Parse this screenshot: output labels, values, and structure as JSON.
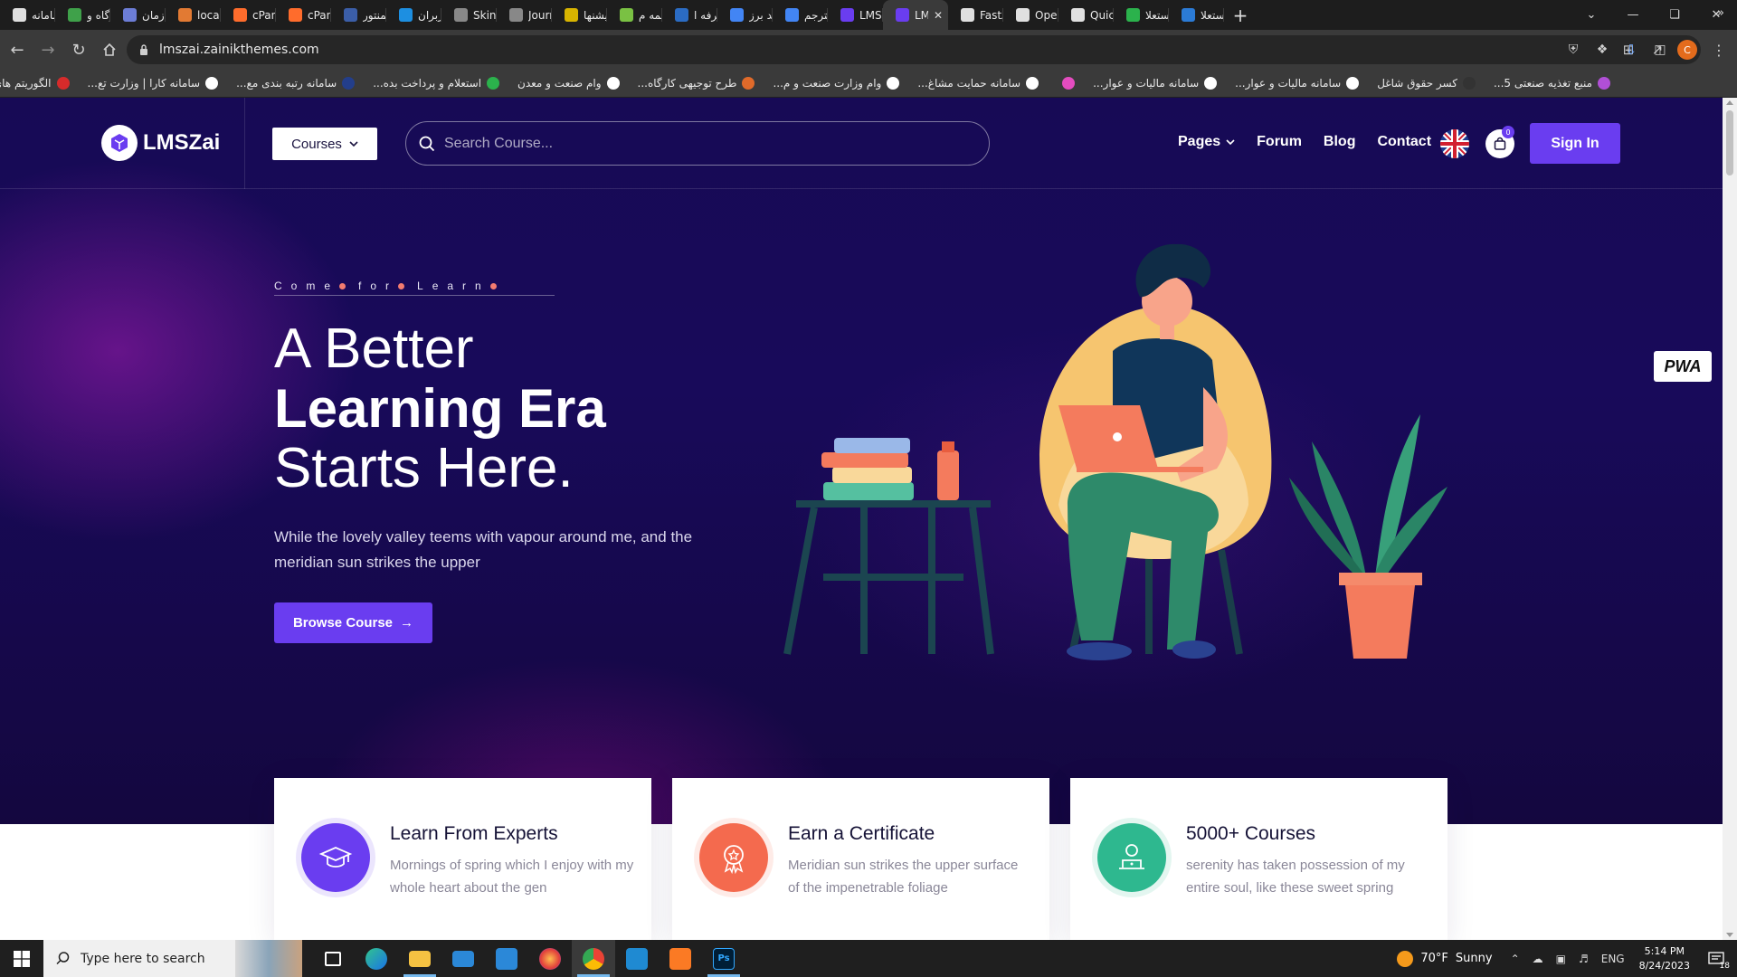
{
  "browser": {
    "tabs": [
      {
        "label": "سامانه",
        "color": "#e0e0e0"
      },
      {
        "label": "درگاه و",
        "color": "#3fa14a"
      },
      {
        "label": "سازمان",
        "color": "#6c7dd6"
      },
      {
        "label": "localh",
        "color": "#e27a33"
      },
      {
        "label": "cPanel",
        "color": "#ff6c2c"
      },
      {
        "label": "cPanel",
        "color": "#ff6c2c"
      },
      {
        "label": "المنتور",
        "color": "#3b5ea8"
      },
      {
        "label": "کاربران",
        "color": "#1d8fe1"
      },
      {
        "label": "Skin",
        "color": "#888888"
      },
      {
        "label": "Journa",
        "color": "#888888"
      },
      {
        "label": "پیشنها",
        "color": "#d8b400"
      },
      {
        "label": "همه م",
        "color": "#7ac143"
      },
      {
        "label": "حرفه ا",
        "color": "#2b6cc4"
      },
      {
        "label": "رعد برز",
        "color": "#4285f4"
      },
      {
        "label": "مترجم",
        "color": "#4285f4"
      },
      {
        "label": "LMSZai",
        "color": "#6a3df0"
      },
      {
        "label": "LM",
        "color": "#6a3df0",
        "active": true
      },
      {
        "label": "FastAi",
        "color": "#e0e0e0"
      },
      {
        "label": "Open",
        "color": "#e0e0e0"
      },
      {
        "label": "Quick",
        "color": "#e0e0e0"
      },
      {
        "label": "استعلا",
        "color": "#2bb24c"
      },
      {
        "label": "استعلا",
        "color": "#2b7bd6"
      }
    ],
    "new_tab_label": "+",
    "url": "lmszai.zainikthemes.com",
    "profile_initial": "C",
    "bookmarks": [
      {
        "label": "منبع تغذیه صنعتی 5...",
        "color": "#b04fd6"
      },
      {
        "label": "کسر حقوق شاغل",
        "color": "#333333"
      },
      {
        "label": "سامانه مالیات و عوار...",
        "color": "#ffffff"
      },
      {
        "label": "سامانه مالیات و عوار...",
        "color": "#ffffff"
      },
      {
        "label": "",
        "color": "#e34cbf"
      },
      {
        "label": "سامانه حمایت مشاغ...",
        "color": "#ffffff"
      },
      {
        "label": "وام وزارت صنعت و م...",
        "color": "#ffffff"
      },
      {
        "label": "طرح توجیهی کارگاه...",
        "color": "#e06a2a"
      },
      {
        "label": "وام صنعت و معدن",
        "color": "#ffffff"
      },
      {
        "label": "استعلام و پرداخت بده...",
        "color": "#2bb24c"
      },
      {
        "label": "سامانه رتبه بندی مع...",
        "color": "#233e8b"
      },
      {
        "label": "سامانه کارا | وزارت تع...",
        "color": "#ffffff"
      },
      {
        "label": "الگوریتم های گوگل |...",
        "color": "#d62b2b"
      }
    ]
  },
  "site": {
    "logo_text": "LMSZai",
    "courses_label": "Courses",
    "search_placeholder": "Search Course...",
    "nav": {
      "pages": "Pages",
      "forum": "Forum",
      "blog": "Blog",
      "contact": "Contact"
    },
    "cart_count": "0",
    "signin_label": "Sign In",
    "hero": {
      "tagline_words": [
        "Come",
        "for",
        "Learn"
      ],
      "headline_line1": "A Better",
      "headline_line2": "Learning Era",
      "headline_line3": "Starts Here.",
      "subtext": "While the lovely valley teems with vapour around me, and the meridian sun strikes the upper",
      "browse_label": "Browse Course"
    },
    "pwa_label": "PWA",
    "features": [
      {
        "title": "Learn From Experts",
        "desc": "Mornings of spring which I enjoy with my whole heart about the gen",
        "icon": "graduation-cap-icon",
        "color": "#6a3df0"
      },
      {
        "title": "Earn a Certificate",
        "desc": "Meridian sun strikes the upper surface of the impenetrable foliage",
        "icon": "certificate-badge-icon",
        "color": "#f46a4e"
      },
      {
        "title": "5000+ Courses",
        "desc": "serenity has taken possession of my entire soul, like these sweet spring",
        "icon": "laptop-student-icon",
        "color": "#2eb88f"
      }
    ],
    "colors": {
      "primary": "#6a3df0",
      "hero_bg": "#170a55",
      "accent_dot": "#f27c70"
    }
  },
  "taskbar": {
    "search_placeholder": "Type here to search",
    "weather_temp": "70°F",
    "weather_desc": "Sunny",
    "language": "ENG",
    "time": "5:14 PM",
    "date": "8/24/2023",
    "notification_count": "18"
  }
}
